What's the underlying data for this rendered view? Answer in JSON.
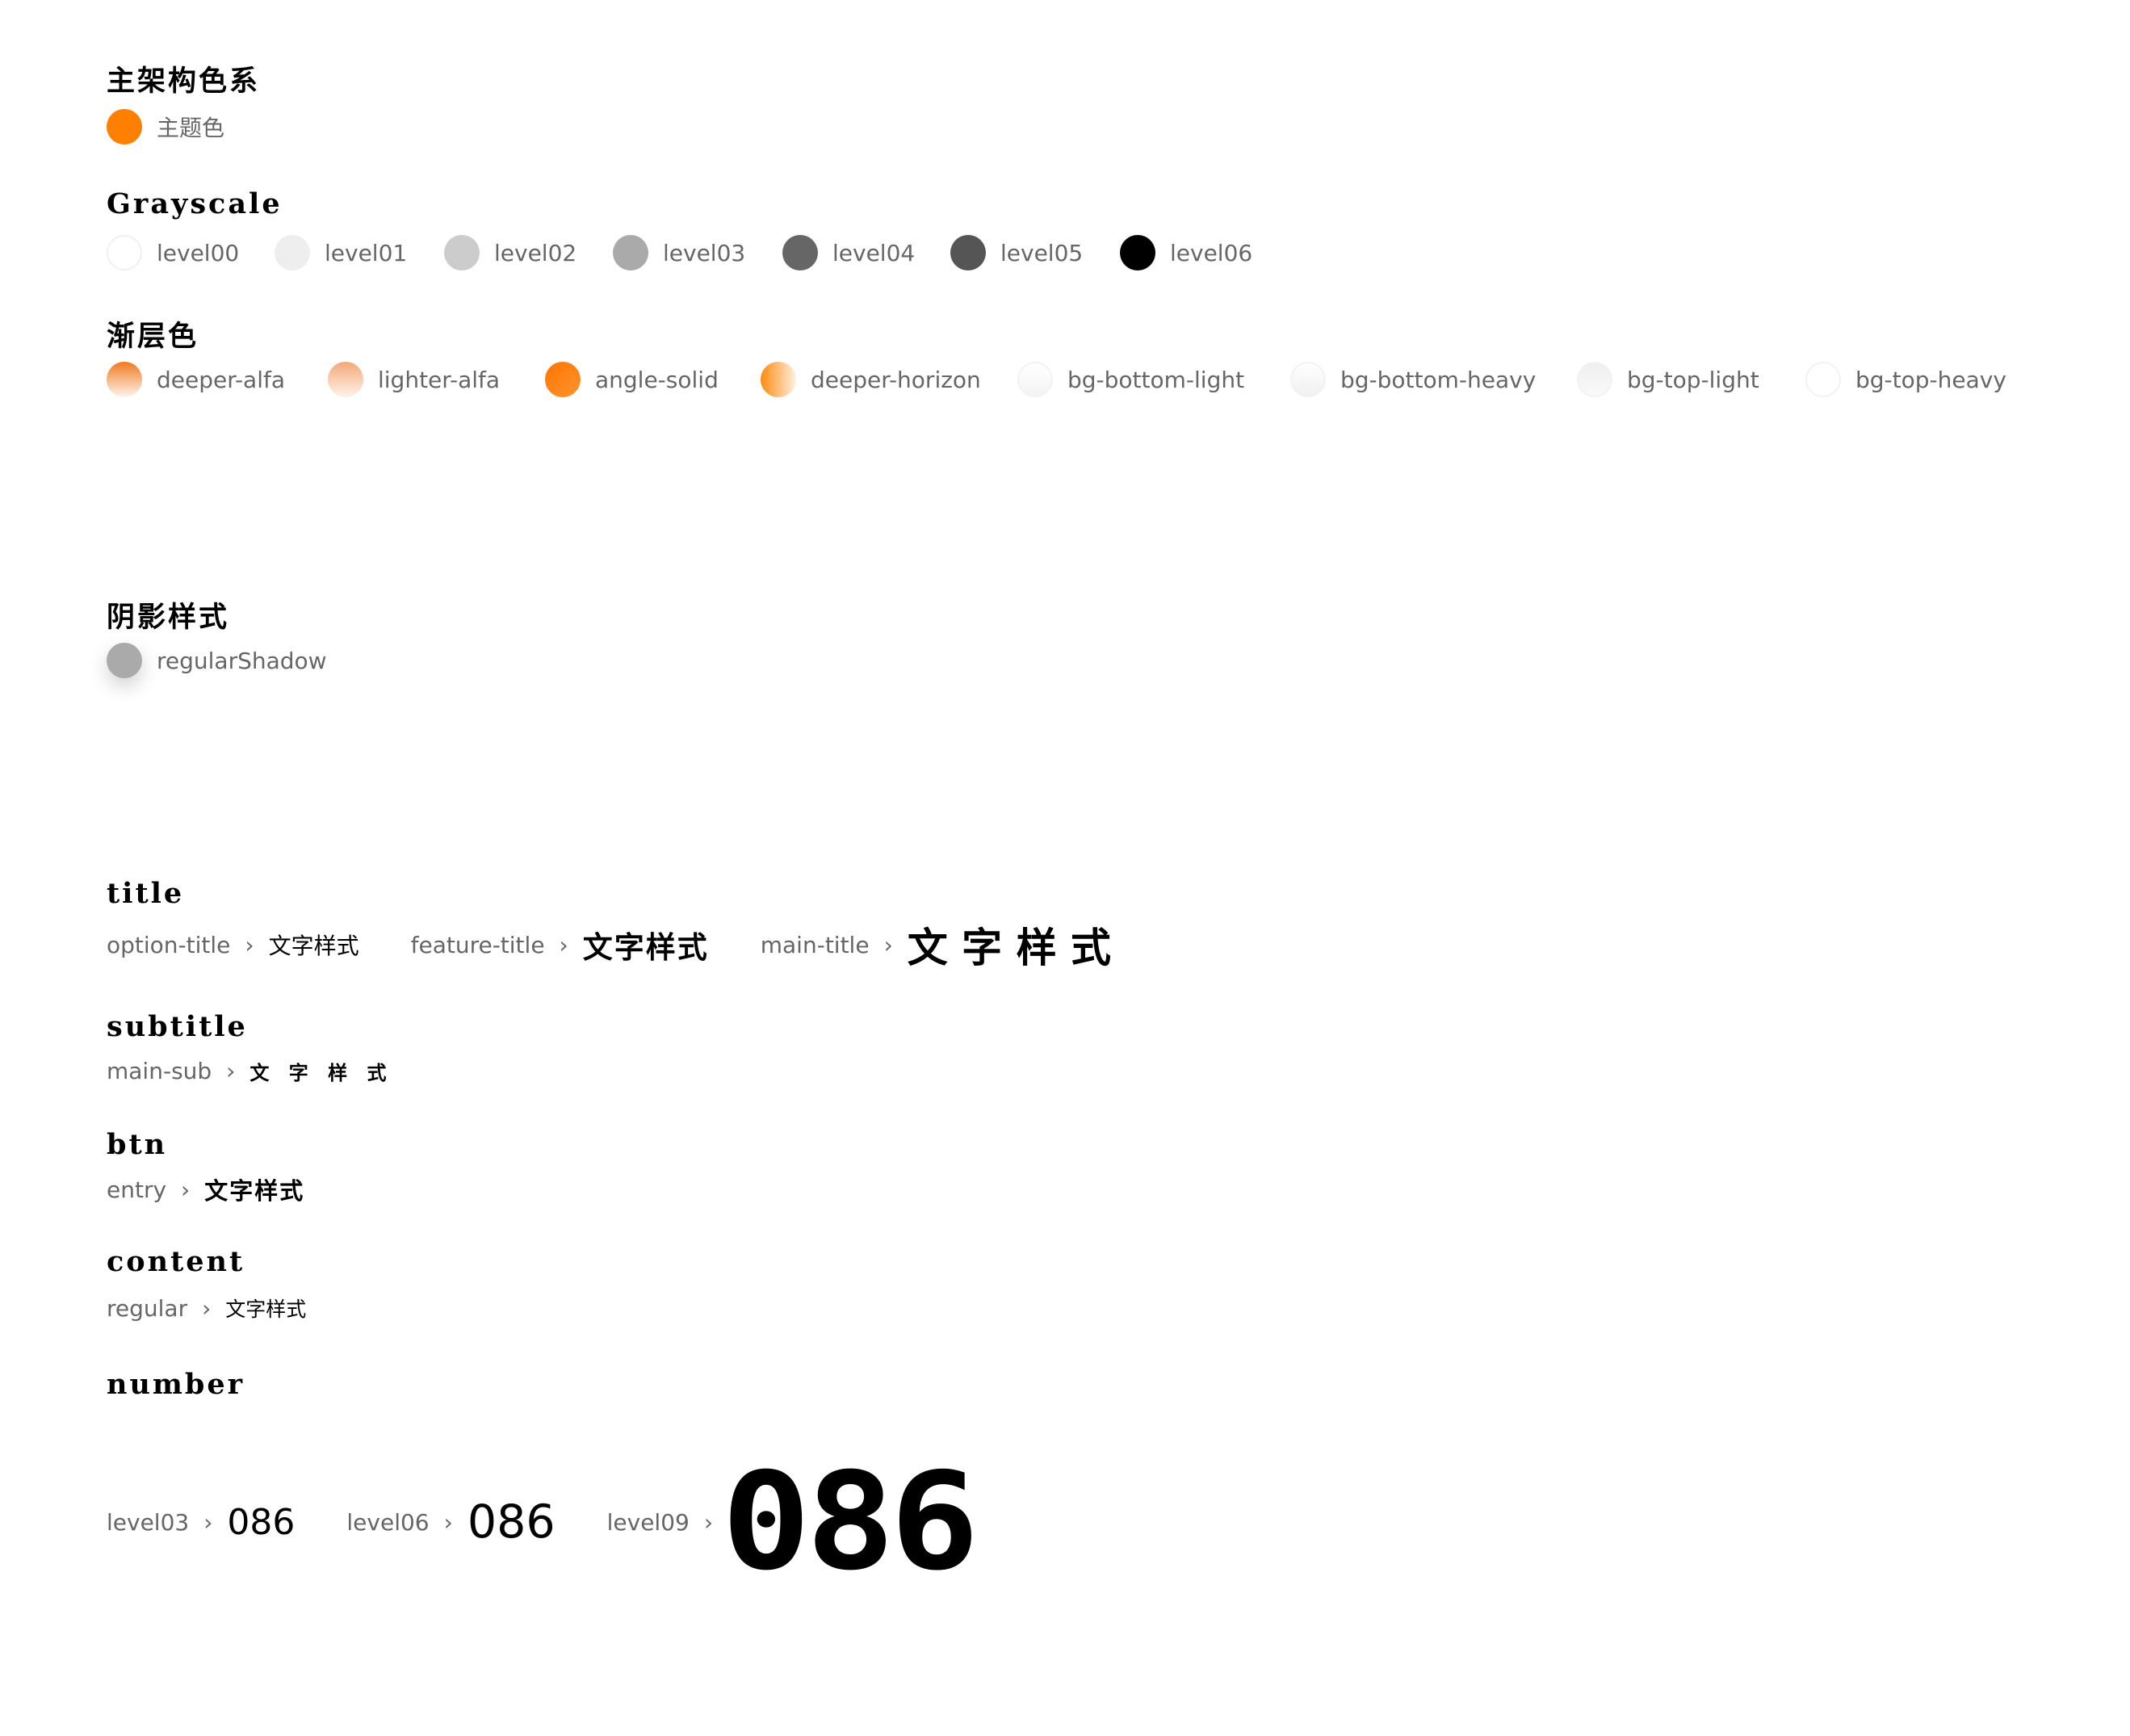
{
  "main_color": {
    "heading": "主架构色系",
    "items": [
      {
        "label": "主题色",
        "color": "#ff7f00"
      }
    ]
  },
  "grayscale": {
    "heading": "Grayscale",
    "items": [
      {
        "label": "level00",
        "color": "#ffffff"
      },
      {
        "label": "level01",
        "color": "#eeeeee"
      },
      {
        "label": "level02",
        "color": "#cccccc"
      },
      {
        "label": "level03",
        "color": "#aaaaaa"
      },
      {
        "label": "level04",
        "color": "#666666"
      },
      {
        "label": "level05",
        "color": "#555555"
      },
      {
        "label": "level06",
        "color": "#000000"
      }
    ]
  },
  "gradient": {
    "heading": "渐层色",
    "items": [
      {
        "label": "deeper-alfa"
      },
      {
        "label": "lighter-alfa"
      },
      {
        "label": "angle-solid"
      },
      {
        "label": "deeper-horizon"
      },
      {
        "label": "bg-bottom-light"
      },
      {
        "label": "bg-bottom-heavy"
      },
      {
        "label": "bg-top-light"
      },
      {
        "label": "bg-top-heavy"
      }
    ]
  },
  "shadow": {
    "heading": "阴影样式",
    "items": [
      {
        "label": "regularShadow"
      }
    ]
  },
  "title": {
    "heading": "title",
    "items": [
      {
        "label": "option-title",
        "sample": "文字样式"
      },
      {
        "label": "feature-title",
        "sample": "文字样式"
      },
      {
        "label": "main-title",
        "sample": "文 字 样 式"
      }
    ]
  },
  "subtitle": {
    "heading": "subtitle",
    "items": [
      {
        "label": "main-sub",
        "sample": "文 字 样 式"
      }
    ]
  },
  "btn": {
    "heading": "btn",
    "items": [
      {
        "label": "entry",
        "sample": "文字样式"
      }
    ]
  },
  "content": {
    "heading": "content",
    "items": [
      {
        "label": "regular",
        "sample": "文字样式"
      }
    ]
  },
  "number": {
    "heading": "number",
    "items": [
      {
        "label": "level03",
        "sample": "086"
      },
      {
        "label": "level06",
        "sample": "086"
      },
      {
        "label": "level09",
        "sample": "086"
      }
    ]
  },
  "arrow": "›"
}
